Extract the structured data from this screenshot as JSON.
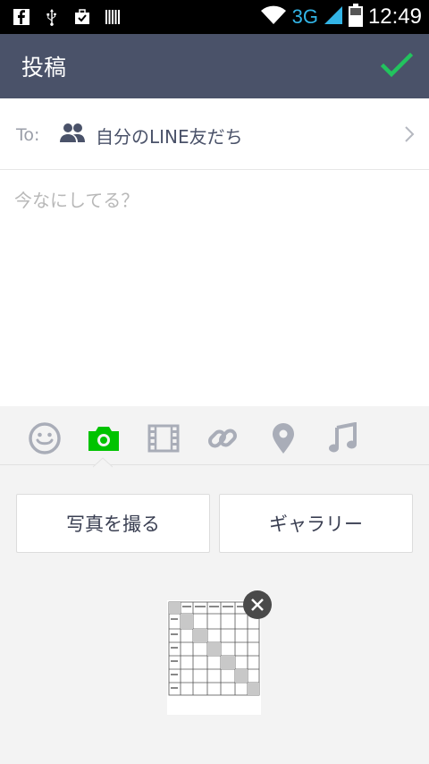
{
  "statusbar": {
    "network": "3G",
    "time": "12:49",
    "icons": [
      "facebook-icon",
      "usb-icon",
      "briefcase-icon",
      "barcode-icon",
      "wifi-icon",
      "signal-icon",
      "battery-icon"
    ]
  },
  "header": {
    "title": "投稿",
    "confirm_icon": "check-icon",
    "confirm_color": "#22c35e",
    "background": "#4a5269"
  },
  "recipient": {
    "label": "To:",
    "value": "自分のLINE友だち",
    "icon": "friends-icon"
  },
  "compose": {
    "placeholder": "今なにしてる？"
  },
  "toolbar": {
    "items": [
      {
        "icon": "sticker-icon",
        "active": false
      },
      {
        "icon": "camera-icon",
        "active": true
      },
      {
        "icon": "video-icon",
        "active": false
      },
      {
        "icon": "link-icon",
        "active": false
      },
      {
        "icon": "location-icon",
        "active": false
      },
      {
        "icon": "music-icon",
        "active": false
      }
    ],
    "active_color": "#00c300",
    "inactive_color": "#a9adb8"
  },
  "actions": {
    "take_photo": "写真を撮る",
    "gallery": "ギャラリー"
  },
  "attachment": {
    "type": "image",
    "remove_icon": "close-icon"
  }
}
